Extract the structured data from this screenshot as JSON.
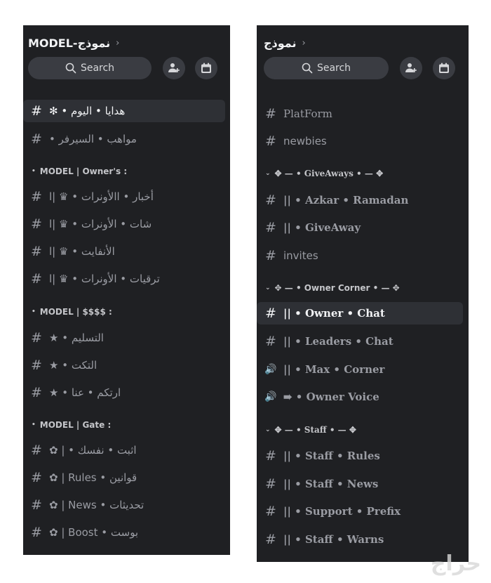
{
  "left": {
    "server_name": "MODEL-نموذج",
    "search_label": "Search",
    "items": [
      {
        "kind": "channel",
        "prefix": "#",
        "label": "✻ • هدايا • اليوم",
        "active": true
      },
      {
        "kind": "channel",
        "prefix": "#",
        "label": "• مواهب • السيرفر"
      },
      {
        "kind": "category",
        "label": "MODEL | Owner's :"
      },
      {
        "kind": "channel",
        "prefix": "#",
        "label": "أخبار • االأونرات • ♛ |ا"
      },
      {
        "kind": "channel",
        "prefix": "#",
        "label": "شات • الأونرات • ♛ |ا"
      },
      {
        "kind": "channel",
        "prefix": "#",
        "label": "الأنفايت • ♛ |ا"
      },
      {
        "kind": "channel",
        "prefix": "#",
        "label": "ترقيات • الأونرات • ♛ |ا"
      },
      {
        "kind": "category",
        "label": "MODEL | $$$$ :"
      },
      {
        "kind": "channel",
        "prefix": "#",
        "label": "★ • التسليم"
      },
      {
        "kind": "channel",
        "prefix": "#",
        "label": "★ • التكت"
      },
      {
        "kind": "channel",
        "prefix": "#",
        "label": "★ • ارتكم • عنا"
      },
      {
        "kind": "category",
        "label": "MODEL | Gate :"
      },
      {
        "kind": "channel",
        "prefix": "#",
        "label": "✿ | • اثبت • نفسك"
      },
      {
        "kind": "channel",
        "prefix": "#",
        "label": "✿ | Rules • قوانين"
      },
      {
        "kind": "channel",
        "prefix": "#",
        "label": "✿ | News • تحديثات"
      },
      {
        "kind": "channel",
        "prefix": "#",
        "label": "✿ | Boost • بوست"
      }
    ]
  },
  "right": {
    "server_name": "نموذج",
    "search_label": "Search",
    "items": [
      {
        "kind": "channel",
        "prefix": "#",
        "label": "PlatForm",
        "serif": true
      },
      {
        "kind": "channel",
        "prefix": "#",
        "label": "newbies"
      },
      {
        "kind": "category",
        "label": "✥ — • GiveAways • — ✥",
        "serif": true
      },
      {
        "kind": "channel",
        "prefix": "#",
        "label": "|| • Azkar • Ramadan",
        "serif": true,
        "bold": true
      },
      {
        "kind": "channel",
        "prefix": "#",
        "label": "|| • GiveAway",
        "serif": true,
        "bold": true
      },
      {
        "kind": "channel",
        "prefix": "#",
        "label": "invites"
      },
      {
        "kind": "category",
        "label": "✥ — • Owner Corner • — ✥"
      },
      {
        "kind": "channel",
        "prefix": "#",
        "label": "|| • Owner • Chat",
        "serif": true,
        "bold": true,
        "active": true
      },
      {
        "kind": "channel",
        "prefix": "#",
        "label": "|| • Leaders • Chat",
        "serif": true,
        "bold": true
      },
      {
        "kind": "voice",
        "prefix": "🔊",
        "label": "|| • Max • Corner",
        "serif": true,
        "bold": true
      },
      {
        "kind": "voice",
        "prefix": "🔊",
        "label": "➠ • Owner Voice",
        "serif": true,
        "bold": true
      },
      {
        "kind": "category",
        "label": "✥ — • Staff • — ✥",
        "serif": true
      },
      {
        "kind": "channel",
        "prefix": "#",
        "label": "|| • Staff • Rules",
        "serif": true,
        "bold": true
      },
      {
        "kind": "channel",
        "prefix": "#",
        "label": "|| • Staff • News",
        "serif": true,
        "bold": true
      },
      {
        "kind": "channel",
        "prefix": "#",
        "label": "|| • Support • Prefix",
        "serif": true,
        "bold": true
      },
      {
        "kind": "channel",
        "prefix": "#",
        "label": "|| • Staff • Warns",
        "serif": true,
        "bold": true
      }
    ]
  },
  "watermark": "حراج"
}
